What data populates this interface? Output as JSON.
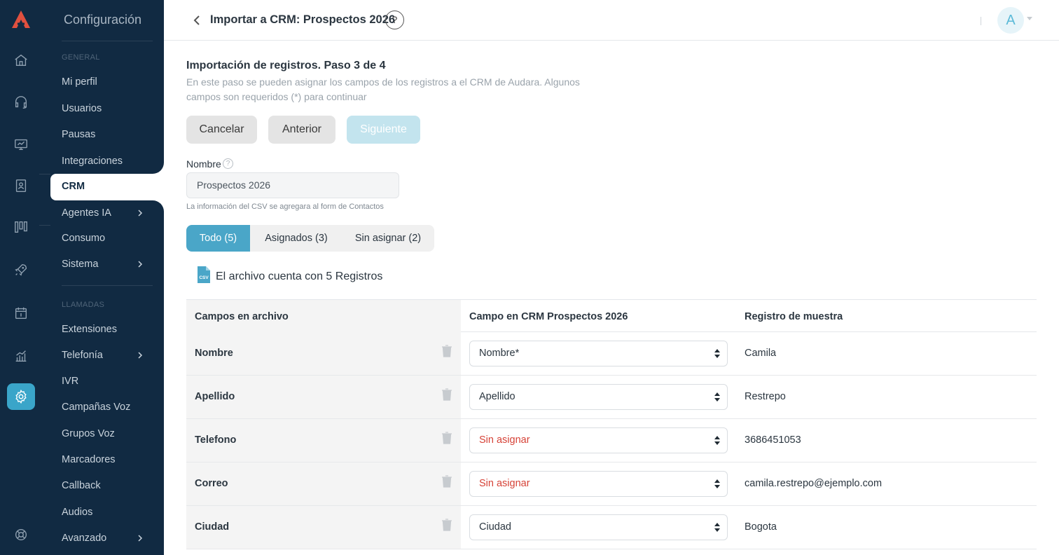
{
  "sidebar": {
    "title": "Configuración",
    "sections": {
      "general": "GENERAL",
      "llamadas": "LLAMADAS"
    },
    "items": [
      {
        "label": "Mi perfil"
      },
      {
        "label": "Usuarios"
      },
      {
        "label": "Pausas"
      },
      {
        "label": "Integraciones"
      },
      {
        "label": "CRM",
        "active": true
      },
      {
        "label": "Agentes IA",
        "has_submenu": true
      },
      {
        "label": "Consumo"
      },
      {
        "label": "Sistema",
        "has_submenu": true
      },
      {
        "label": "Extensiones"
      },
      {
        "label": "Telefonía",
        "has_submenu": true
      },
      {
        "label": "IVR"
      },
      {
        "label": "Campañas Voz"
      },
      {
        "label": "Grupos Voz"
      },
      {
        "label": "Marcadores"
      },
      {
        "label": "Callback"
      },
      {
        "label": "Audios"
      },
      {
        "label": "Avanzado",
        "has_submenu": true
      }
    ]
  },
  "rail": {
    "icons": [
      "logo-icon",
      "home-icon",
      "headset-icon",
      "monitor-icon",
      "contacts-book-icon",
      "kanban-icon",
      "rocket-icon",
      "calendar-icon",
      "analytics-icon",
      "gear-icon",
      "support-icon"
    ],
    "active": "gear-icon"
  },
  "header": {
    "title": "Importar a CRM: Prospectos 2026",
    "help": "?",
    "avatar_initial": "A"
  },
  "step": {
    "title": "Importación de registros. Paso 3 de 4",
    "description": "En este paso se pueden asignar los campos de los registros a el CRM de Audara. Algunos campos son requeridos (*) para continuar"
  },
  "buttons": {
    "cancel": "Cancelar",
    "previous": "Anterior",
    "next": "Siguiente"
  },
  "name_field": {
    "label": "Nombre",
    "help": "?",
    "value": "Prospectos 2026",
    "note": "La información del CSV se agregara al form de Contactos"
  },
  "tabs": [
    {
      "label": "Todo (5)",
      "active": true
    },
    {
      "label": "Asignados  (3)"
    },
    {
      "label": "Sin asignar (2)"
    }
  ],
  "file_info": "El archivo cuenta con 5 Registros",
  "table": {
    "headers": [
      "Campos en archivo",
      "Campo en CRM Prospectos 2026",
      "Registro de muestra"
    ],
    "rows": [
      {
        "field": "Nombre",
        "crm": "Nombre*",
        "unassigned": false,
        "sample": "Camila"
      },
      {
        "field": "Apellido",
        "crm": "Apellido",
        "unassigned": false,
        "sample": "Restrepo"
      },
      {
        "field": "Telefono",
        "crm": "Sin asignar",
        "unassigned": true,
        "sample": "3686451053"
      },
      {
        "field": "Correo",
        "crm": "Sin asignar",
        "unassigned": true,
        "sample": "camila.restrepo@ejemplo.com"
      },
      {
        "field": "Ciudad",
        "crm": "Ciudad",
        "unassigned": false,
        "sample": "Bogota"
      }
    ]
  },
  "colors": {
    "sidebar_bg": "#112a42",
    "accent": "#4aa6c8",
    "unassigned": "#d64237",
    "logo": "#e0503f"
  }
}
